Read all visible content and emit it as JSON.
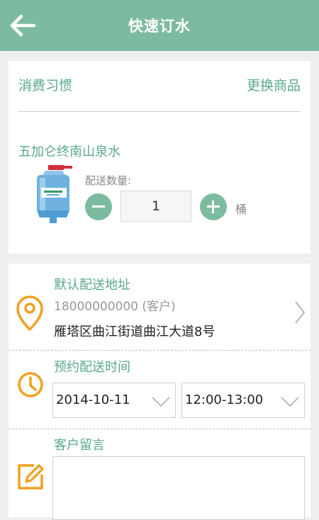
{
  "header": {
    "title": "快速订水",
    "back_icon": "arrow-left-icon"
  },
  "product_card": {
    "habit_label": "消费习惯",
    "change_label": "更换商品",
    "product_name": "五加仑终南山泉水",
    "quantity_label": "配送数量:",
    "quantity_value": "1",
    "unit": "桶",
    "product_image_icon": "water-bottle-image"
  },
  "address": {
    "title": "默认配送地址",
    "phone": "18000000000 (客户)",
    "detail": "雁塔区曲江街道曲江大道8号",
    "icon": "location-pin-icon"
  },
  "delivery_time": {
    "title": "预约配送时间",
    "date": "2014-10-11",
    "time_slot": "12:00-13:00",
    "icon": "clock-icon"
  },
  "message": {
    "title": "客户留言",
    "icon": "edit-icon",
    "value": ""
  },
  "colors": {
    "primary": "#7dbba0",
    "label_green": "#5aa98a",
    "accent_orange": "#f0a020"
  }
}
